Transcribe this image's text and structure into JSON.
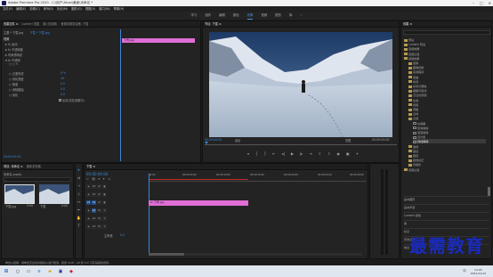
{
  "window": {
    "title": "Adobe Premiere Pro 2020 - C:\\用户\\Xhao\\桌面\\未命名 *",
    "controls": [
      "–",
      "□",
      "✕"
    ]
  },
  "menu": [
    "文件(F)",
    "编辑(E)",
    "剪辑(C)",
    "序列(S)",
    "标记(M)",
    "图形(G)",
    "视图(V)",
    "窗口(W)",
    "帮助(H)"
  ],
  "workspaces": {
    "items": [
      "学习",
      "组件",
      "编辑",
      "颜色",
      "效果",
      "音频",
      "图形",
      "库"
    ],
    "active_index": 4,
    "more": "»"
  },
  "effect_controls": {
    "tabs": [
      "效果控件 ≡",
      "Lumetri 范围",
      "源:(无剪辑)",
      "音频剪辑混合器: 下雪"
    ],
    "clip_path": "主要 * 下雪.jpg",
    "sequence": "下雪 * 下雪.jpg",
    "header_video": "视频",
    "clip_bar_label": "下雪.jpg",
    "rows": [
      {
        "label": "fx 运动",
        "value": ""
      },
      {
        "label": "fx 不透明度",
        "value": ""
      },
      {
        "label": "时间重映射",
        "value": ""
      },
      {
        "label": "fx 不透明",
        "value": ""
      },
      {
        "label": "○ 过渡完成",
        "value": "0 %"
      },
      {
        "label": "○ 羽化宽度",
        "value": "40"
      },
      {
        "label": "○ 角度",
        "value": "0.0"
      },
      {
        "label": "○ 消除锯齿",
        "value": "0.0"
      },
      {
        "label": "○ 羽化",
        "value": "0.0"
      }
    ],
    "checkbox_label": "反向(仅在剪辑中)",
    "timecode": "00:00:00:00"
  },
  "program_monitor": {
    "tab": "节目: 下雪 ≡",
    "timecode_left": "00:00:00:00",
    "fit": "适合",
    "quality": "完整",
    "timecode_right": "00:00:05:00"
  },
  "project": {
    "tabs": [
      "项目: 未命名 ≡",
      "媒体浏览器"
    ],
    "name": "未命名.prproj",
    "items": [
      {
        "name": "下雪.jpg",
        "duration": "5:00"
      },
      {
        "name": "下雪",
        "duration": "5:00"
      }
    ]
  },
  "timeline": {
    "tab": "下雪 ≡",
    "timecode": "00:00:00:00",
    "ruler": [
      "00:00",
      "00:00:05:00",
      "00:00:10:00",
      "00:00:15:00",
      "00:00:20:00",
      "00:00:25:00",
      "00:00:30:00"
    ],
    "tracks": [
      {
        "name": "V3",
        "kind": "video"
      },
      {
        "name": "V2",
        "kind": "video"
      },
      {
        "name": "V1",
        "kind": "video"
      },
      {
        "name": "A1",
        "kind": "audio"
      },
      {
        "name": "A2",
        "kind": "audio"
      },
      {
        "name": "A3",
        "kind": "audio"
      }
    ],
    "master": "主声道",
    "master_value": "0.0",
    "clip": "fx 下雪.jpg"
  },
  "effects": {
    "tab": "效果 ≡",
    "tree": [
      {
        "label": "预设",
        "indent": 0
      },
      {
        "label": "Lumetri 预设",
        "indent": 0
      },
      {
        "label": "音频效果",
        "indent": 0
      },
      {
        "label": "音频过渡",
        "indent": 0
      },
      {
        "label": "视频效果",
        "indent": 0
      },
      {
        "label": "变换",
        "indent": 1
      },
      {
        "label": "图像控制",
        "indent": 1
      },
      {
        "label": "实用程序",
        "indent": 1
      },
      {
        "label": "扭曲",
        "indent": 1
      },
      {
        "label": "时间",
        "indent": 1
      },
      {
        "label": "杂色与颗粒",
        "indent": 1
      },
      {
        "label": "模糊与锐化",
        "indent": 1
      },
      {
        "label": "沉浸式视频",
        "indent": 1
      },
      {
        "label": "生成",
        "indent": 1
      },
      {
        "label": "视频",
        "indent": 1
      },
      {
        "label": "调整",
        "indent": 1
      },
      {
        "label": "过时",
        "indent": 1
      },
      {
        "label": "过渡",
        "indent": 1
      },
      {
        "label": "块溶解",
        "indent": 2
      },
      {
        "label": "径向擦除",
        "indent": 2
      },
      {
        "label": "渐变擦除",
        "indent": 2
      },
      {
        "label": "百叶窗",
        "indent": 2
      },
      {
        "label": "线性擦除",
        "indent": 2
      },
      {
        "label": "透视",
        "indent": 1
      },
      {
        "label": "通道",
        "indent": 1
      },
      {
        "label": "键控",
        "indent": 1
      },
      {
        "label": "颜色校正",
        "indent": 1
      },
      {
        "label": "风格化",
        "indent": 1
      },
      {
        "label": "视频过渡",
        "indent": 0
      }
    ],
    "selected_index": 22,
    "bottom_items": [
      "基本图形",
      "基本声音",
      "Lumetri 颜色",
      "库",
      "标记",
      "历史记录",
      "信息"
    ]
  },
  "status": "单击以选择，或单击空白处并拖动以进行框选。使用 Shift、Alt 和 Ctrl 可获得其他选项。",
  "taskbar": {
    "time": "14:05",
    "date": "2021/11/12",
    "lang": "中"
  },
  "watermark": "最需教育",
  "colors": {
    "accent": "#3b87d8",
    "clip": "#e06ed6",
    "workspace_active": "#4c8fd8"
  }
}
